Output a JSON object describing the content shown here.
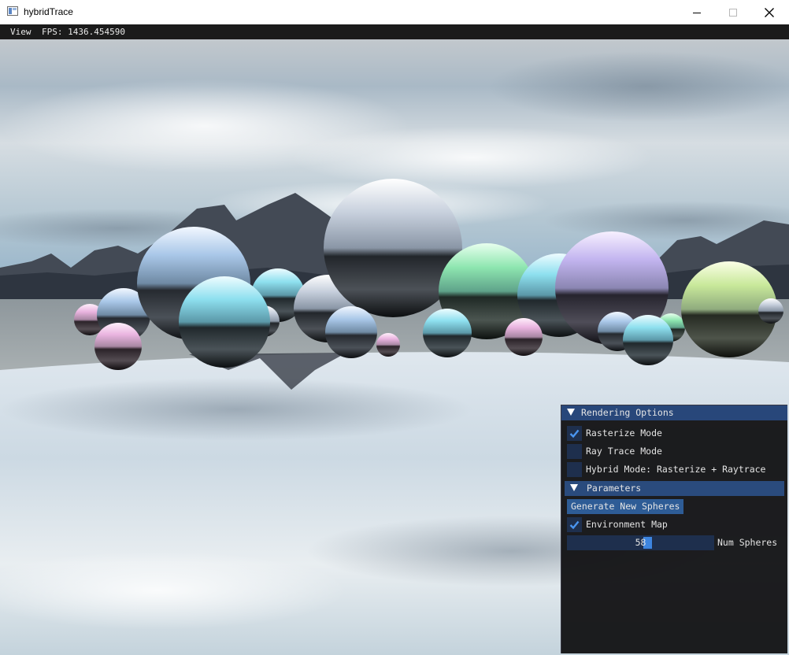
{
  "window": {
    "title": "hybridTrace",
    "icon": "app-window-icon",
    "controls": [
      "minimize-icon",
      "maximize-icon",
      "close-icon"
    ]
  },
  "menubar": {
    "view_label": "View",
    "fps_text": "FPS: 1436.454590"
  },
  "panel": {
    "title": "Rendering Options",
    "options": [
      {
        "label": "Rasterize Mode",
        "checked": true
      },
      {
        "label": "Ray Trace Mode",
        "checked": false
      },
      {
        "label": "Hybrid Mode: Rasterize + Raytrace",
        "checked": false
      }
    ],
    "parameters": {
      "header": "Parameters",
      "generate_button": "Generate New Spheres",
      "environment_map": {
        "label": "Environment Map",
        "checked": true
      },
      "num_spheres": {
        "value": "58",
        "label": "Num Spheres",
        "fraction": 0.55
      }
    }
  },
  "colors": {
    "accent": "#3d85e0",
    "header": "#28477a",
    "frame_bg": "#1e2f4d",
    "panel_bg": "#141416"
  }
}
